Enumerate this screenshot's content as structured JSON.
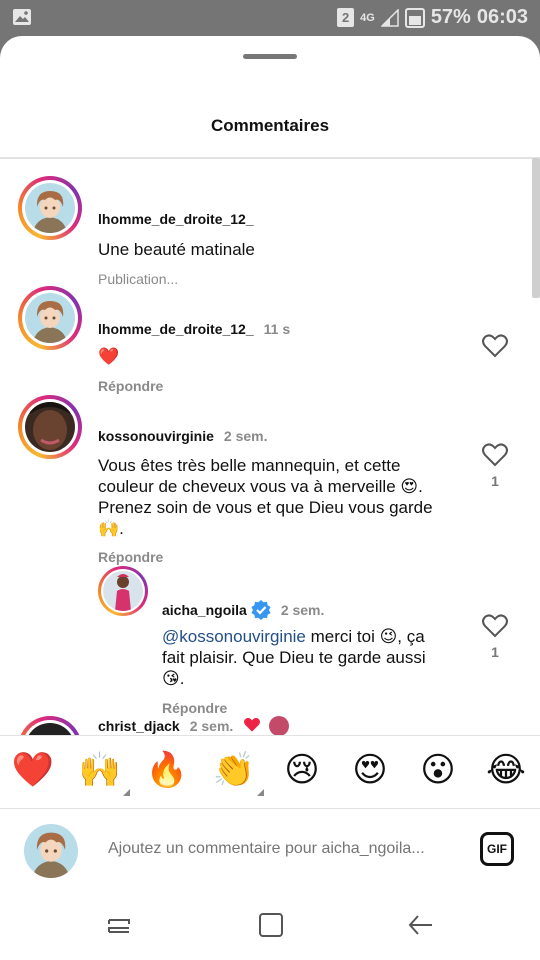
{
  "status_bar": {
    "notification_icon": "gallery-icon",
    "sim_badge": "2",
    "network_label": "4G",
    "battery": "57%",
    "time": "06:03"
  },
  "sheet": {
    "title": "Commentaires"
  },
  "comments": [
    {
      "username": "lhomme_de_droite_12_",
      "time": "",
      "text": "Une beauté matinale",
      "meta": "Publication...",
      "avatar": "anime-boy-avatar"
    },
    {
      "username": "lhomme_de_droite_12_",
      "time": "11 s",
      "text": "❤️",
      "meta": "Répondre",
      "avatar": "anime-boy-avatar"
    },
    {
      "username": "kossonouvirginie",
      "time": "2 sem.",
      "text_lines": [
        "Vous êtes très belle mannequin, et cette",
        "couleur de cheveux vous va à merveille 😍.",
        "Prenez soin de vous et que Dieu vous garde",
        "🙌."
      ],
      "likes": "1",
      "meta": "Répondre",
      "avatar": "woman-selfie-avatar"
    },
    {
      "username": "aicha_ngoila",
      "time": "2 sem.",
      "verified": true,
      "mention": "@kossonouvirginie",
      "text_lines": [
        " merci toi 😉, ça",
        "fait plaisir. Que Dieu te garde aussi",
        "😘."
      ],
      "likes": "1",
      "meta": "Répondre",
      "avatar": "woman-red-dress-avatar"
    },
    {
      "username": "christ_djack",
      "time": "2 sem.",
      "avatar": "dark-avatar"
    }
  ],
  "emoji_bar": [
    "❤️",
    "🙌",
    "🔥",
    "👏",
    "😢",
    "😍",
    "😮",
    "😂"
  ],
  "composer": {
    "placeholder": "Ajoutez un commentaire pour aicha_ngoila...",
    "gif_label": "GIF"
  },
  "colors": {
    "accent_gradient": [
      "#f7b733",
      "#f58529",
      "#dd2a7b",
      "#8134af"
    ],
    "verified_blue": "#3797f0",
    "mention_blue": "#234f87"
  }
}
